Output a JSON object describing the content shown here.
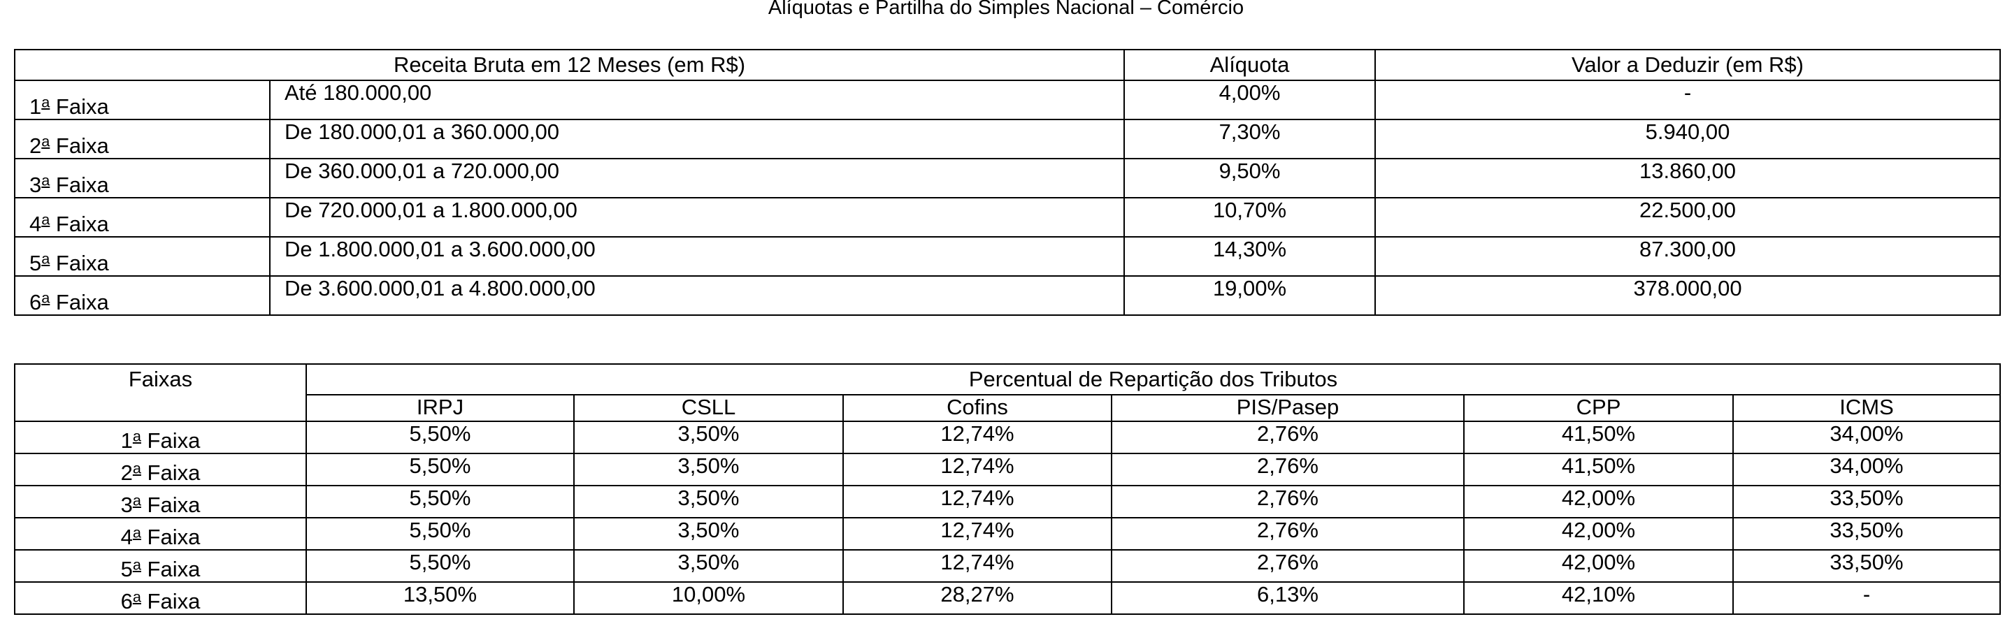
{
  "title": "Alíquotas e Partilha do Simples Nacional – Comércio",
  "table1": {
    "headers": [
      "Receita Bruta em 12 Meses (em R$)",
      "Alíquota",
      "Valor a Deduzir (em R$)"
    ],
    "rows": [
      {
        "num": "1",
        "ord": "a",
        "faixa": " Faixa",
        "range": "Até 180.000,00",
        "aliquota": "4,00%",
        "deduzir": "-"
      },
      {
        "num": "2",
        "ord": "a",
        "faixa": " Faixa",
        "range": "De 180.000,01 a 360.000,00",
        "aliquota": "7,30%",
        "deduzir": "5.940,00"
      },
      {
        "num": "3",
        "ord": "a",
        "faixa": " Faixa",
        "range": "De 360.000,01 a 720.000,00",
        "aliquota": "9,50%",
        "deduzir": "13.860,00"
      },
      {
        "num": "4",
        "ord": "a",
        "faixa": " Faixa",
        "range": "De 720.000,01 a 1.800.000,00",
        "aliquota": "10,70%",
        "deduzir": "22.500,00"
      },
      {
        "num": "5",
        "ord": "a",
        "faixa": " Faixa",
        "range": "De 1.800.000,01 a 3.600.000,00",
        "aliquota": "14,30%",
        "deduzir": "87.300,00"
      },
      {
        "num": "6",
        "ord": "a",
        "faixa": " Faixa",
        "range": "De 3.600.000,01 a 4.800.000,00",
        "aliquota": "19,00%",
        "deduzir": "378.000,00"
      }
    ]
  },
  "table2": {
    "faixas_header": "Faixas",
    "group_header": "Percentual de Repartição dos Tributos",
    "columns": [
      "IRPJ",
      "CSLL",
      "Cofins",
      "PIS/Pasep",
      "CPP",
      "ICMS"
    ],
    "rows": [
      {
        "num": "1",
        "ord": "a",
        "faixa": " Faixa",
        "values": [
          "5,50%",
          "3,50%",
          "12,74%",
          "2,76%",
          "41,50%",
          "34,00%"
        ]
      },
      {
        "num": "2",
        "ord": "a",
        "faixa": " Faixa",
        "values": [
          "5,50%",
          "3,50%",
          "12,74%",
          "2,76%",
          "41,50%",
          "34,00%"
        ]
      },
      {
        "num": "3",
        "ord": "a",
        "faixa": " Faixa",
        "values": [
          "5,50%",
          "3,50%",
          "12,74%",
          "2,76%",
          "42,00%",
          "33,50%"
        ]
      },
      {
        "num": "4",
        "ord": "a",
        "faixa": " Faixa",
        "values": [
          "5,50%",
          "3,50%",
          "12,74%",
          "2,76%",
          "42,00%",
          "33,50%"
        ]
      },
      {
        "num": "5",
        "ord": "a",
        "faixa": " Faixa",
        "values": [
          "5,50%",
          "3,50%",
          "12,74%",
          "2,76%",
          "42,00%",
          "33,50%"
        ]
      },
      {
        "num": "6",
        "ord": "a",
        "faixa": " Faixa",
        "values": [
          "13,50%",
          "10,00%",
          "28,27%",
          "6,13%",
          "42,10%",
          "-"
        ]
      }
    ]
  }
}
